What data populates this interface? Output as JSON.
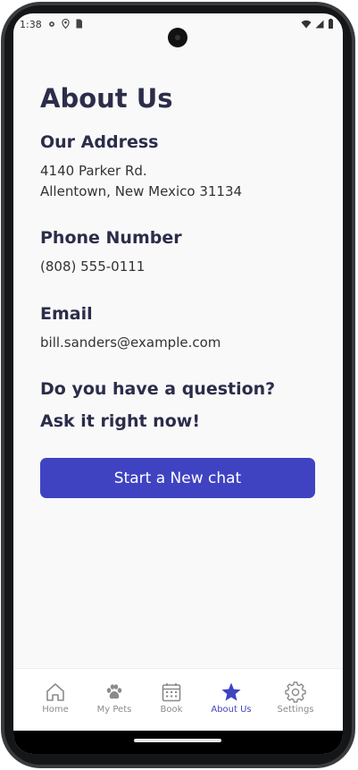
{
  "status": {
    "time": "1:38",
    "icons_left": [
      "gear-icon",
      "location-icon",
      "sim-card-icon"
    ],
    "icons_right": [
      "wifi-icon",
      "signal-icon",
      "battery-icon"
    ]
  },
  "page": {
    "title": "About Us",
    "address": {
      "heading": "Our Address",
      "line1": "4140 Parker Rd.",
      "line2": "Allentown, New Mexico 31134"
    },
    "phone": {
      "heading": "Phone Number",
      "value": "(808) 555-0111"
    },
    "email": {
      "heading": "Email",
      "value": "bill.sanders@example.com"
    },
    "question": {
      "line1": "Do you have a question?",
      "line2": "Ask it right now!"
    },
    "cta_label": "Start a New chat"
  },
  "nav": {
    "items": [
      {
        "label": "Home",
        "icon": "home-icon"
      },
      {
        "label": "My Pets",
        "icon": "paw-icon"
      },
      {
        "label": "Book",
        "icon": "calendar-icon"
      },
      {
        "label": "About Us",
        "icon": "star-icon",
        "active": true
      },
      {
        "label": "Settings",
        "icon": "gear-icon"
      }
    ]
  },
  "colors": {
    "accent": "#3f43c2",
    "heading": "#2b2d4a",
    "nav_inactive": "#8a8a8a",
    "background": "#f9f9f9"
  }
}
